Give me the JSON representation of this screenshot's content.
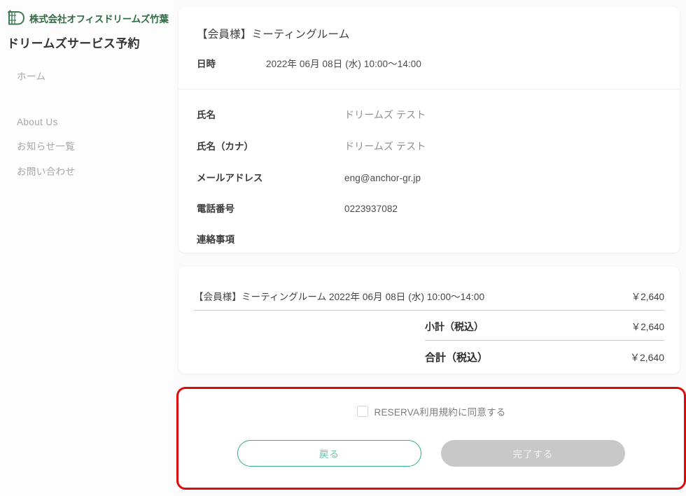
{
  "sidebar": {
    "company_name": "株式会社オフィスドリームズ竹葉",
    "site_title": "ドリームズサービス予約",
    "nav_home": "ホーム",
    "nav_items": [
      {
        "label": "About Us"
      },
      {
        "label": "お知らせ一覧"
      },
      {
        "label": "お問い合わせ"
      }
    ]
  },
  "detail_card": {
    "title": "【会員様】ミーティングルーム",
    "datetime_label": "日時",
    "datetime_value": "2022年 06月 08日 (水) 10:00〜14:00",
    "fields": [
      {
        "label": "氏名",
        "value": "ドリームズ テスト",
        "muted": true
      },
      {
        "label": "氏名（カナ）",
        "value": "ドリームズ テスト",
        "muted": true
      },
      {
        "label": "メールアドレス",
        "value": "eng@anchor-gr.jp",
        "muted": false
      },
      {
        "label": "電話番号",
        "value": "0223937082",
        "muted": false
      },
      {
        "label": "連絡事項",
        "value": "",
        "muted": false
      }
    ]
  },
  "price_card": {
    "item_name": "【会員様】ミーティングルーム  2022年 06月 08日 (水) 10:00〜14:00",
    "item_amount": "￥2,640",
    "subtotal_label": "小計（税込）",
    "subtotal_amount": "￥2,640",
    "total_label": "合計（税込）",
    "total_amount": "￥2,640"
  },
  "action_area": {
    "agree_label": "RESERVA利用規約に同意する",
    "agree_checked": false,
    "back_button": "戻る",
    "submit_button": "完了する",
    "submit_disabled": true
  },
  "colors": {
    "brand_green": "#2f6b45",
    "accent_teal": "#2fae87",
    "highlight_red": "#dc0a0a",
    "disabled_grey": "#c8c8c8",
    "page_bg": "#fbfbfb",
    "card_bg": "#ffffff"
  }
}
